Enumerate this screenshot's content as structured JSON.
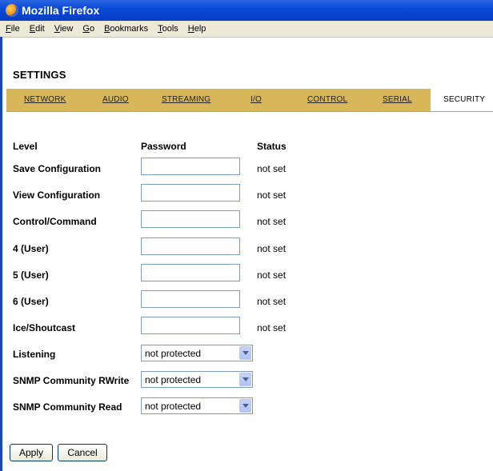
{
  "window": {
    "title": "Mozilla Firefox"
  },
  "menu": [
    {
      "label": "File",
      "key": "F",
      "rest": "ile"
    },
    {
      "label": "Edit",
      "key": "E",
      "rest": "dit"
    },
    {
      "label": "View",
      "key": "V",
      "rest": "iew"
    },
    {
      "label": "Go",
      "key": "G",
      "rest": "o"
    },
    {
      "label": "Bookmarks",
      "key": "B",
      "rest": "ookmarks"
    },
    {
      "label": "Tools",
      "key": "T",
      "rest": "ools"
    },
    {
      "label": "Help",
      "key": "H",
      "rest": "elp"
    }
  ],
  "page": {
    "title": "SETTINGS"
  },
  "tabs": [
    {
      "label": "NETWORK"
    },
    {
      "label": "AUDIO"
    },
    {
      "label": "STREAMING"
    },
    {
      "label": "I/O"
    },
    {
      "label": "CONTROL"
    },
    {
      "label": "SERIAL"
    },
    {
      "label": "SECURITY",
      "active": true
    }
  ],
  "headers": {
    "level": "Level",
    "password": "Password",
    "status": "Status"
  },
  "password_rows": [
    {
      "level": "Save Configuration",
      "value": "",
      "status": "not set"
    },
    {
      "level": "View Configuration",
      "value": "",
      "status": "not set"
    },
    {
      "level": "Control/Command",
      "value": "",
      "status": "not set"
    },
    {
      "level": "4 (User)",
      "value": "",
      "status": "not set"
    },
    {
      "level": "5 (User)",
      "value": "",
      "status": "not set"
    },
    {
      "level": "6 (User)",
      "value": "",
      "status": "not set"
    },
    {
      "level": "Ice/Shoutcast",
      "value": "",
      "status": "not set"
    }
  ],
  "select_rows": [
    {
      "level": "Listening",
      "value": "not protected"
    },
    {
      "level": "SNMP Community RWrite",
      "value": "not protected"
    },
    {
      "level": "SNMP Community Read",
      "value": "not protected"
    }
  ],
  "buttons": {
    "apply": "Apply",
    "cancel": "Cancel"
  }
}
